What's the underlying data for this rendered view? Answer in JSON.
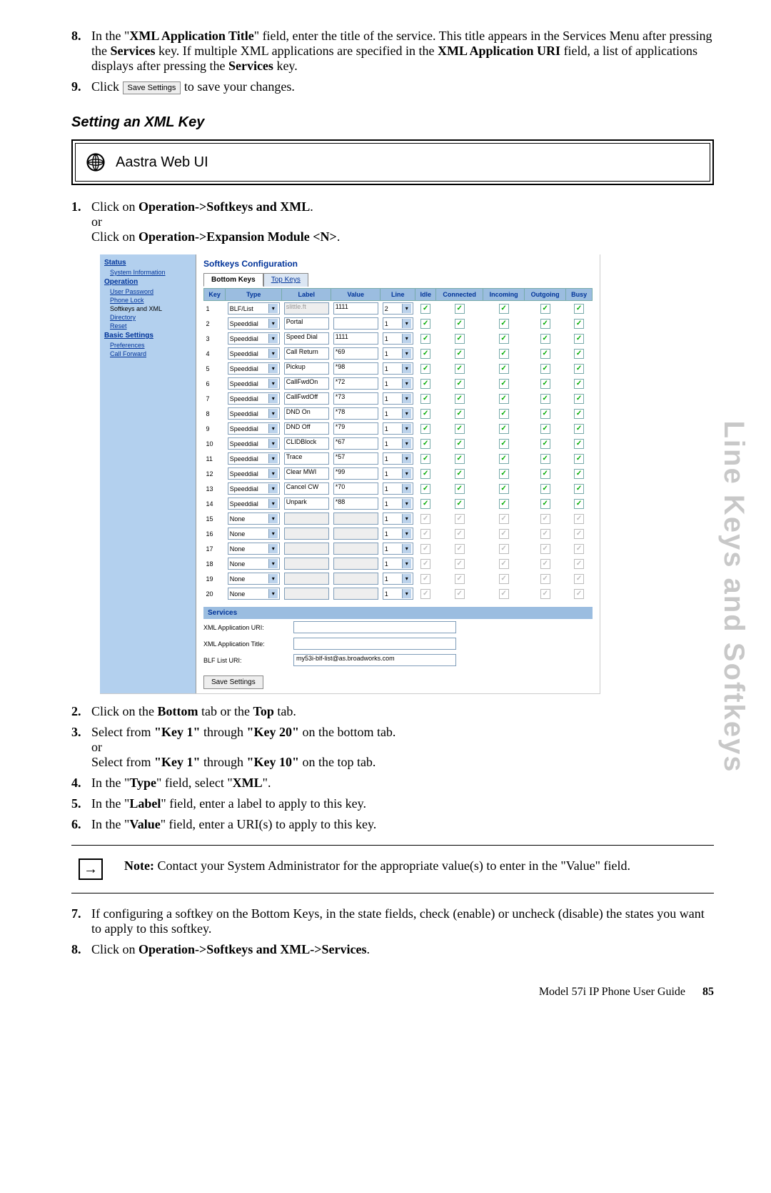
{
  "step8": {
    "num": "8.",
    "t1": "In the \"",
    "b1": "XML Application Title",
    "t2": "\" field, enter the title of the service. This title appears in the Services Menu after pressing the ",
    "b2": "Services",
    "t3": " key. If multiple XML applications are specified in the ",
    "b3": "XML Application URI",
    "t4": " field, a list of applica­tions displays after pressing the ",
    "b4": "Services",
    "t5": " key."
  },
  "step9": {
    "num": "9.",
    "pre": "Click ",
    "btn": "Save Settings",
    "post": " to save your changes."
  },
  "section_title": "Setting an XML Key",
  "webui": "Aastra Web UI",
  "inst1": {
    "num": "1.",
    "a": "Click on ",
    "b": "Operation->Softkeys and XML",
    "c": ".",
    "or": "or",
    "d": "Click on ",
    "e": "Operation->Expansion Module <N>",
    "f": "."
  },
  "side": {
    "status": "Status",
    "sysinfo": "System Information",
    "operation": "Operation",
    "userpw": "User Password",
    "phonelock": "Phone Lock",
    "softkeys": "Softkeys and XML",
    "directory": "Directory",
    "reset": "Reset",
    "basic": "Basic Settings",
    "prefs": "Preferences",
    "callfwd": "Call Forward"
  },
  "sc": {
    "title": "Softkeys Configuration",
    "tab_bottom": "Bottom Keys",
    "tab_top": "Top Keys",
    "h_key": "Key",
    "h_type": "Type",
    "h_label": "Label",
    "h_value": "Value",
    "h_line": "Line",
    "h_idle": "Idle",
    "h_conn": "Connected",
    "h_inc": "Incoming",
    "h_out": "Outgoing",
    "h_busy": "Busy",
    "rows": [
      {
        "k": "1",
        "type": "BLF/List",
        "label": "slittle.ft",
        "value": "1111",
        "line": "2",
        "dis": false,
        "ldis": true
      },
      {
        "k": "2",
        "type": "Speeddial",
        "label": "Portal",
        "value": "",
        "line": "1",
        "dis": false
      },
      {
        "k": "3",
        "type": "Speeddial",
        "label": "Speed Dial",
        "value": "1111",
        "line": "1",
        "dis": false
      },
      {
        "k": "4",
        "type": "Speeddial",
        "label": "Call Return",
        "value": "*69",
        "line": "1",
        "dis": false
      },
      {
        "k": "5",
        "type": "Speeddial",
        "label": "Pickup",
        "value": "*98",
        "line": "1",
        "dis": false
      },
      {
        "k": "6",
        "type": "Speeddial",
        "label": "CallFwdOn",
        "value": "*72",
        "line": "1",
        "dis": false
      },
      {
        "k": "7",
        "type": "Speeddial",
        "label": "CallFwdOff",
        "value": "*73",
        "line": "1",
        "dis": false
      },
      {
        "k": "8",
        "type": "Speeddial",
        "label": "DND On",
        "value": "*78",
        "line": "1",
        "dis": false
      },
      {
        "k": "9",
        "type": "Speeddial",
        "label": "DND Off",
        "value": "*79",
        "line": "1",
        "dis": false
      },
      {
        "k": "10",
        "type": "Speeddial",
        "label": "CLIDBlock",
        "value": "*67",
        "line": "1",
        "dis": false
      },
      {
        "k": "11",
        "type": "Speeddial",
        "label": "Trace",
        "value": "*57",
        "line": "1",
        "dis": false
      },
      {
        "k": "12",
        "type": "Speeddial",
        "label": "Clear MWI",
        "value": "*99",
        "line": "1",
        "dis": false
      },
      {
        "k": "13",
        "type": "Speeddial",
        "label": "Cancel CW",
        "value": "*70",
        "line": "1",
        "dis": false
      },
      {
        "k": "14",
        "type": "Speeddial",
        "label": "Unpark",
        "value": "*88",
        "line": "1",
        "dis": false
      },
      {
        "k": "15",
        "type": "None",
        "label": "",
        "value": "",
        "line": "1",
        "dis": true
      },
      {
        "k": "16",
        "type": "None",
        "label": "",
        "value": "",
        "line": "1",
        "dis": true
      },
      {
        "k": "17",
        "type": "None",
        "label": "",
        "value": "",
        "line": "1",
        "dis": true
      },
      {
        "k": "18",
        "type": "None",
        "label": "",
        "value": "",
        "line": "1",
        "dis": true
      },
      {
        "k": "19",
        "type": "None",
        "label": "",
        "value": "",
        "line": "1",
        "dis": true
      },
      {
        "k": "20",
        "type": "None",
        "label": "",
        "value": "",
        "line": "1",
        "dis": true
      }
    ],
    "services": "Services",
    "xml_uri_lbl": "XML Application URI:",
    "xml_title_lbl": "XML Application Title:",
    "blf_lbl": "BLF List URI:",
    "blf_val": "my53i-blf-list@as.broadworks.com",
    "save": "Save Settings"
  },
  "inst2": {
    "num": "2.",
    "a": "Click on the ",
    "b": "Bottom",
    "c": " tab or the ",
    "d": "Top",
    "e": " tab."
  },
  "inst3": {
    "num": "3.",
    "a": "Select from ",
    "b": "\"Key 1\"",
    "c": " through ",
    "d": "\"Key 20\"",
    "e": " on the bottom tab.",
    "or": "or",
    "f": "Select from ",
    "g": "\"Key 1\"",
    "h": " through ",
    "i": "\"Key 10\"",
    "j": " on the top tab."
  },
  "inst4": {
    "num": "4.",
    "a": "In the \"",
    "b": "Type",
    "c": "\" field, select \"",
    "d": "XML",
    "e": "\"."
  },
  "inst5": {
    "num": "5.",
    "a": "In the \"",
    "b": "Label",
    "c": "\" field, enter a label to apply to this key."
  },
  "inst6": {
    "num": "6.",
    "a": "In the \"",
    "b": "Value",
    "c": "\" field, enter a URI(s) to apply to this key."
  },
  "note": {
    "lead": "Note:",
    "body": " Contact your System Administrator for the appropriate value(s) to enter in the \"Value\" field."
  },
  "inst7": {
    "num": "7.",
    "body": "If configuring a softkey on the Bottom Keys, in the state fields, check (enable) or uncheck (disable) the states you want to apply to this softkey."
  },
  "inst8": {
    "num": "8.",
    "a": "Click on ",
    "b": "Operation->Softkeys and XML->Services",
    "c": "."
  },
  "side_title": "Line Keys and Softkeys",
  "footer": {
    "text": "Model 57i IP Phone User Guide",
    "page": "85"
  }
}
